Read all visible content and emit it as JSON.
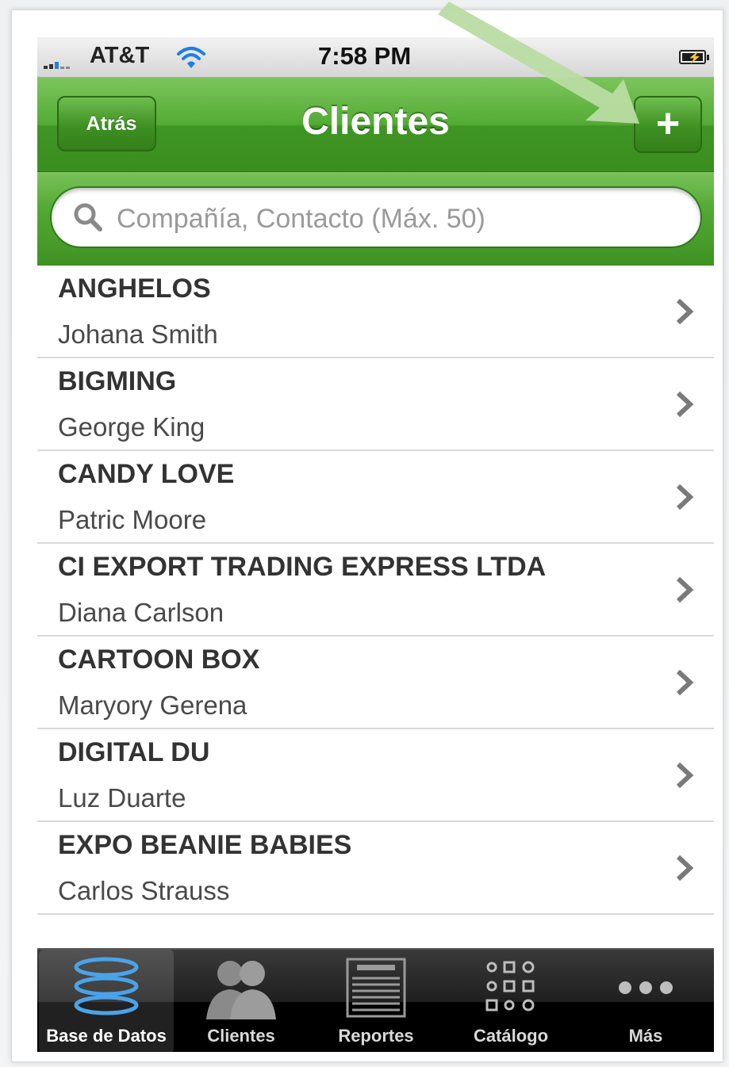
{
  "status_bar": {
    "carrier": "AT&T",
    "time": "7:58 PM"
  },
  "nav": {
    "back_label": "Atrás",
    "title": "Clientes",
    "add_label": "+"
  },
  "search": {
    "placeholder": "Compañía, Contacto (Máx. 50)"
  },
  "clients": [
    {
      "company": "ANGHELOS",
      "contact": "Johana Smith"
    },
    {
      "company": "BIGMING",
      "contact": "George King"
    },
    {
      "company": "CANDY LOVE",
      "contact": "Patric Moore"
    },
    {
      "company": "CI EXPORT TRADING EXPRESS LTDA",
      "contact": "Diana Carlson"
    },
    {
      "company": "CARTOON BOX",
      "contact": "Maryory Gerena"
    },
    {
      "company": "DIGITAL DU",
      "contact": "Luz Duarte"
    },
    {
      "company": "EXPO BEANIE BABIES",
      "contact": "Carlos Strauss"
    }
  ],
  "tabs": [
    {
      "label": "Base de Datos",
      "icon": "database-icon"
    },
    {
      "label": "Clientes",
      "icon": "people-icon"
    },
    {
      "label": "Reportes",
      "icon": "report-icon"
    },
    {
      "label": "Catálogo",
      "icon": "catalog-icon"
    },
    {
      "label": "Más",
      "icon": "more-icon"
    }
  ],
  "colors": {
    "nav_green": "#53ab34",
    "arrow_green": "#b9dca3"
  }
}
